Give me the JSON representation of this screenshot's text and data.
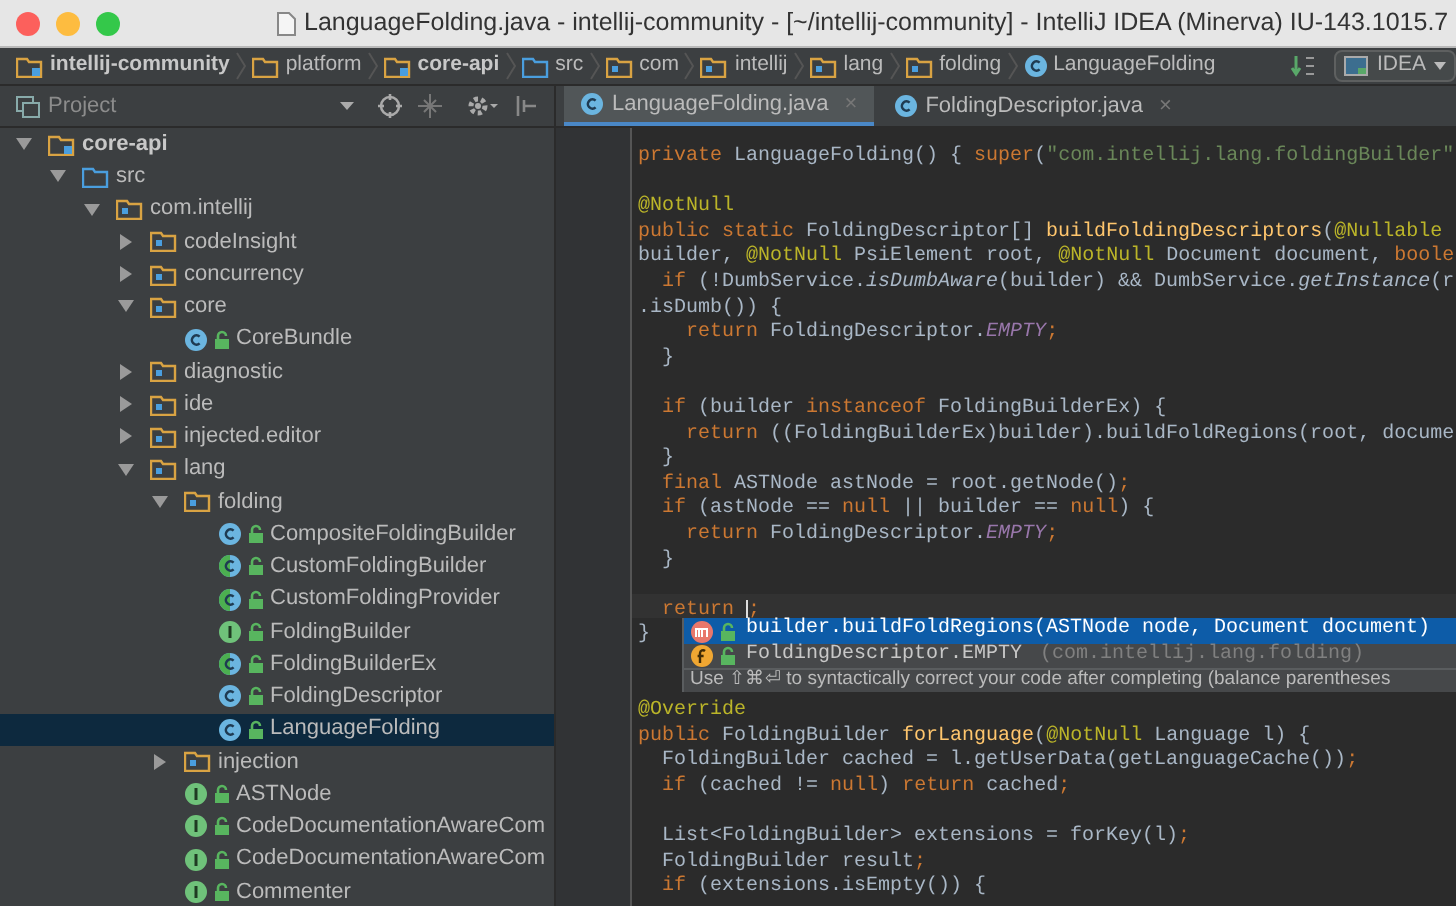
{
  "window": {
    "title": "LanguageFolding.java - intellij-community - [~/intellij-community] - IntelliJ IDEA (Minerva) IU-143.1015.7"
  },
  "breadcrumbs": [
    {
      "label": "intellij-community",
      "kind": "module"
    },
    {
      "label": "platform",
      "kind": "folder"
    },
    {
      "label": "core-api",
      "kind": "module"
    },
    {
      "label": "src",
      "kind": "source"
    },
    {
      "label": "com",
      "kind": "package"
    },
    {
      "label": "intellij",
      "kind": "package"
    },
    {
      "label": "lang",
      "kind": "package"
    },
    {
      "label": "folding",
      "kind": "package"
    },
    {
      "label": "LanguageFolding",
      "kind": "class"
    }
  ],
  "run_config": {
    "label": "IDEA"
  },
  "project_panel": {
    "title": "Project",
    "tree": [
      {
        "label": "core-api",
        "kind": "module",
        "expanded": true,
        "children": [
          {
            "label": "src",
            "kind": "source",
            "expanded": true,
            "children": [
              {
                "label": "com.intellij",
                "kind": "package",
                "expanded": true,
                "children": [
                  {
                    "label": "codeInsight",
                    "kind": "package",
                    "expanded": false
                  },
                  {
                    "label": "concurrency",
                    "kind": "package",
                    "expanded": false
                  },
                  {
                    "label": "core",
                    "kind": "package",
                    "expanded": true,
                    "children": [
                      {
                        "label": "CoreBundle",
                        "kind": "class",
                        "selected": false
                      }
                    ]
                  },
                  {
                    "label": "diagnostic",
                    "kind": "package",
                    "expanded": false
                  },
                  {
                    "label": "ide",
                    "kind": "package",
                    "expanded": false
                  },
                  {
                    "label": "injected.editor",
                    "kind": "package",
                    "expanded": false
                  },
                  {
                    "label": "lang",
                    "kind": "package",
                    "expanded": true,
                    "children": [
                      {
                        "label": "folding",
                        "kind": "package",
                        "expanded": true,
                        "children": [
                          {
                            "label": "CompositeFoldingBuilder",
                            "kind": "class",
                            "selected": false
                          },
                          {
                            "label": "CustomFoldingBuilder",
                            "kind": "abstract",
                            "selected": false
                          },
                          {
                            "label": "CustomFoldingProvider",
                            "kind": "abstract",
                            "selected": false
                          },
                          {
                            "label": "FoldingBuilder",
                            "kind": "interface",
                            "selected": false
                          },
                          {
                            "label": "FoldingBuilderEx",
                            "kind": "abstract",
                            "selected": false
                          },
                          {
                            "label": "FoldingDescriptor",
                            "kind": "class",
                            "selected": false
                          },
                          {
                            "label": "LanguageFolding",
                            "kind": "class",
                            "selected": true
                          }
                        ]
                      },
                      {
                        "label": "injection",
                        "kind": "package",
                        "expanded": false
                      },
                      {
                        "label": "ASTNode",
                        "kind": "interface",
                        "selected": false
                      },
                      {
                        "label": "CodeDocumentationAwareCom",
                        "kind": "interface",
                        "selected": false
                      },
                      {
                        "label": "CodeDocumentationAwareCom",
                        "kind": "interface",
                        "selected": false
                      },
                      {
                        "label": "Commenter",
                        "kind": "interface",
                        "selected": false
                      }
                    ]
                  }
                ]
              }
            ]
          }
        ]
      }
    ]
  },
  "tabs": [
    {
      "label": "LanguageFolding.java",
      "selected": true,
      "close": "×"
    },
    {
      "label": "FoldingDescriptor.java",
      "selected": false,
      "close": "×"
    }
  ],
  "code": [
    {
      "kind": "code",
      "segments": [
        {
          "t": "private",
          "kind": "kw"
        },
        {
          "t": " LanguageFolding() { ",
          "kind": "plain"
        },
        {
          "t": "super",
          "kind": "kw"
        },
        {
          "t": "(",
          "kind": "plain"
        },
        {
          "t": "\"com.intellij.lang.foldingBuilder\"",
          "kind": "str"
        }
      ]
    },
    {
      "kind": "blank"
    },
    {
      "kind": "code",
      "segments": [
        {
          "t": "@NotNull",
          "kind": "ann"
        }
      ]
    },
    {
      "kind": "code",
      "segments": [
        {
          "t": "public static",
          "kind": "kw"
        },
        {
          "t": " FoldingDescriptor[] ",
          "kind": "plain"
        },
        {
          "t": "buildFoldingDescriptors",
          "kind": "fn"
        },
        {
          "t": "(",
          "kind": "plain"
        },
        {
          "t": "@Nullable",
          "kind": "ann"
        }
      ]
    },
    {
      "kind": "code",
      "segments": [
        {
          "t": "builder, ",
          "kind": "plain"
        },
        {
          "t": "@NotNull",
          "kind": "ann"
        },
        {
          "t": " PsiElement root, ",
          "kind": "plain"
        },
        {
          "t": "@NotNull",
          "kind": "ann"
        },
        {
          "t": " Document document, ",
          "kind": "plain"
        },
        {
          "t": "boole",
          "kind": "kw"
        }
      ]
    },
    {
      "kind": "code",
      "segments": [
        {
          "t": "  if",
          "kind": "kw"
        },
        {
          "t": " (!DumbService.",
          "kind": "plain"
        },
        {
          "t": "isDumbAware",
          "kind": "ital"
        },
        {
          "t": "(builder) && DumbService.",
          "kind": "plain"
        },
        {
          "t": "getInstance",
          "kind": "ital"
        },
        {
          "t": "(r",
          "kind": "plain"
        }
      ]
    },
    {
      "kind": "code",
      "segments": [
        {
          "t": ".isDumb()) {",
          "kind": "plain"
        }
      ]
    },
    {
      "kind": "code",
      "segments": [
        {
          "t": "    return",
          "kind": "kw"
        },
        {
          "t": " FoldingDescriptor.",
          "kind": "plain"
        },
        {
          "t": "EMPTY",
          "kind": "const"
        },
        {
          "t": ";",
          "kind": "kw"
        }
      ]
    },
    {
      "kind": "code",
      "segments": [
        {
          "t": "  }",
          "kind": "plain"
        }
      ]
    },
    {
      "kind": "blank"
    },
    {
      "kind": "code",
      "segments": [
        {
          "t": "  if",
          "kind": "kw"
        },
        {
          "t": " (builder ",
          "kind": "plain"
        },
        {
          "t": "instanceof",
          "kind": "kw"
        },
        {
          "t": " FoldingBuilderEx) {",
          "kind": "plain"
        }
      ]
    },
    {
      "kind": "code",
      "segments": [
        {
          "t": "    return",
          "kind": "kw"
        },
        {
          "t": " ((FoldingBuilderEx)builder).buildFoldRegions(root, docume",
          "kind": "plain"
        }
      ]
    },
    {
      "kind": "code",
      "segments": [
        {
          "t": "  }",
          "kind": "plain"
        }
      ]
    },
    {
      "kind": "code",
      "segments": [
        {
          "t": "  final",
          "kind": "kw"
        },
        {
          "t": " ASTNode astNode = root.getNode()",
          "kind": "plain"
        },
        {
          "t": ";",
          "kind": "kw"
        }
      ]
    },
    {
      "kind": "code",
      "segments": [
        {
          "t": "  if",
          "kind": "kw"
        },
        {
          "t": " (astNode == ",
          "kind": "plain"
        },
        {
          "t": "null",
          "kind": "kw"
        },
        {
          "t": " || builder == ",
          "kind": "plain"
        },
        {
          "t": "null",
          "kind": "kw"
        },
        {
          "t": ") {",
          "kind": "plain"
        }
      ]
    },
    {
      "kind": "code",
      "segments": [
        {
          "t": "    return",
          "kind": "kw"
        },
        {
          "t": " FoldingDescriptor.",
          "kind": "plain"
        },
        {
          "t": "EMPTY",
          "kind": "const"
        },
        {
          "t": ";",
          "kind": "kw"
        }
      ]
    },
    {
      "kind": "code",
      "segments": [
        {
          "t": "  }",
          "kind": "plain"
        }
      ]
    },
    {
      "kind": "blank"
    },
    {
      "kind": "code",
      "current": true,
      "segments": [
        {
          "t": "  return ",
          "kind": "kw"
        },
        {
          "t": ";",
          "kind": "caret"
        }
      ]
    },
    {
      "kind": "code",
      "popup": true,
      "segments": [
        {
          "t": "}",
          "kind": "plain"
        }
      ]
    },
    {
      "kind": "blank"
    },
    {
      "kind": "blank"
    },
    {
      "kind": "code",
      "segments": [
        {
          "t": "@Override",
          "kind": "ann"
        }
      ]
    },
    {
      "kind": "code",
      "segments": [
        {
          "t": "public",
          "kind": "kw"
        },
        {
          "t": " FoldingBuilder ",
          "kind": "plain"
        },
        {
          "t": "forLanguage",
          "kind": "fn"
        },
        {
          "t": "(",
          "kind": "plain"
        },
        {
          "t": "@NotNull",
          "kind": "ann"
        },
        {
          "t": " Language l) {",
          "kind": "plain"
        }
      ]
    },
    {
      "kind": "code",
      "segments": [
        {
          "t": "  FoldingBuilder cached = l.getUserData(getLanguageCache())",
          "kind": "plain"
        },
        {
          "t": ";",
          "kind": "kw"
        }
      ]
    },
    {
      "kind": "code",
      "segments": [
        {
          "t": "  if",
          "kind": "kw"
        },
        {
          "t": " (cached != ",
          "kind": "plain"
        },
        {
          "t": "null",
          "kind": "kw"
        },
        {
          "t": ") ",
          "kind": "plain"
        },
        {
          "t": "return",
          "kind": "kw"
        },
        {
          "t": " cached",
          "kind": "plain"
        },
        {
          "t": ";",
          "kind": "kw"
        }
      ]
    },
    {
      "kind": "blank"
    },
    {
      "kind": "code",
      "segments": [
        {
          "t": "  List<FoldingBuilder> extensions = forKey(l)",
          "kind": "plain"
        },
        {
          "t": ";",
          "kind": "kw"
        }
      ]
    },
    {
      "kind": "code",
      "segments": [
        {
          "t": "  FoldingBuilder result",
          "kind": "plain"
        },
        {
          "t": ";",
          "kind": "kw"
        }
      ]
    },
    {
      "kind": "code",
      "segments": [
        {
          "t": "  if",
          "kind": "kw"
        },
        {
          "t": " (extensions.isEmpty()) {",
          "kind": "plain"
        }
      ]
    }
  ],
  "completion": {
    "items": [
      {
        "kind": "method",
        "text": "builder.buildFoldRegions(ASTNode node, Document document)",
        "selected": true
      },
      {
        "kind": "field",
        "text": "FoldingDescriptor.EMPTY",
        "hint": "(com.intellij.lang.folding)",
        "selected": false
      }
    ],
    "footer": "Use ⇧⌘⏎ to syntactically correct your code after completing (balance parentheses"
  }
}
